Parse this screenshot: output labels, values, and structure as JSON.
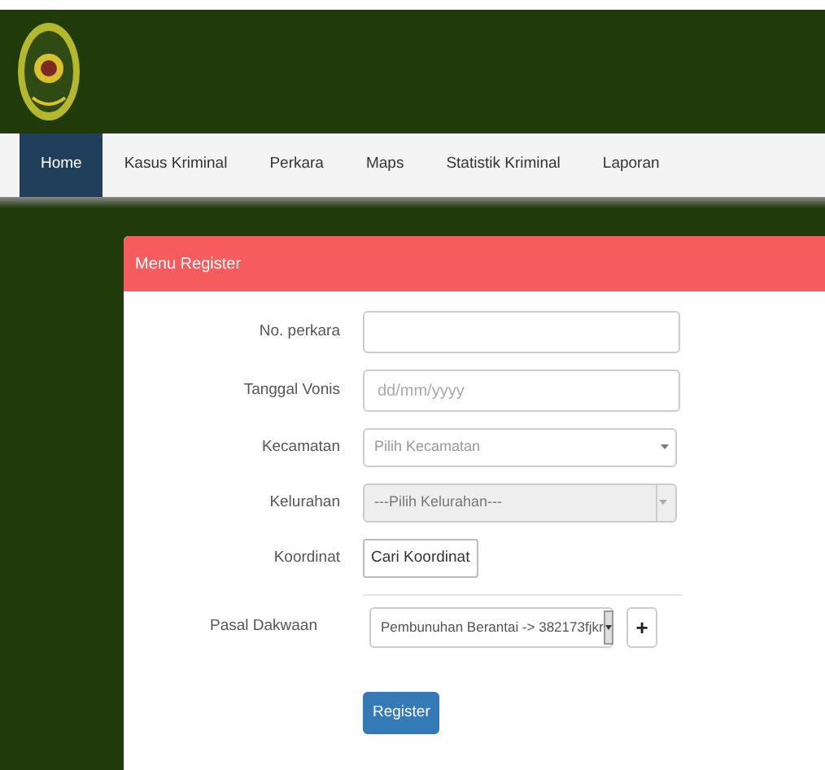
{
  "nav": {
    "items": [
      {
        "label": "Home",
        "selected": true
      },
      {
        "label": "Kasus Kriminal",
        "selected": false
      },
      {
        "label": "Perkara",
        "selected": false
      },
      {
        "label": "Maps",
        "selected": false
      },
      {
        "label": "Statistik Kriminal",
        "selected": false
      },
      {
        "label": "Laporan",
        "selected": false
      }
    ]
  },
  "card": {
    "title": "Menu Register",
    "fields": [
      {
        "kind": "text",
        "label": "No. perkara"
      },
      {
        "kind": "text",
        "label": "Tanggal Vonis",
        "placeholder": "dd/mm/yyyy"
      },
      {
        "kind": "select",
        "label": "Kecamatan",
        "placeholder": "Pilih Kecamatan",
        "disabled": false
      },
      {
        "kind": "select",
        "label": "Kelurahan",
        "placeholder": "---Pilih Kelurahan---",
        "disabled": true
      },
      {
        "kind": "button",
        "label": "Koordinat",
        "button": "Cari Koordinat"
      },
      {
        "kind": "pasal",
        "label": "Pasal Dakwaan",
        "value": "Pembunuhan Berantai -> 382173fjkr",
        "add": "+"
      }
    ],
    "submit": "Register"
  }
}
